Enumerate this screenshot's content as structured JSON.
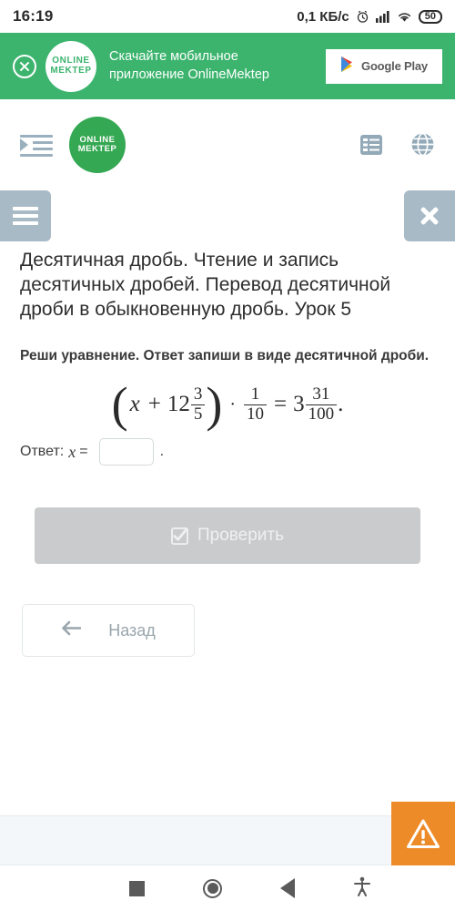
{
  "statusbar": {
    "time": "16:19",
    "network_speed": "0,1 КБ/с",
    "alarm_icon": "alarm-clock-icon",
    "signal_icon": "cellular-signal-icon",
    "wifi_icon": "wifi-icon",
    "battery_level": "50"
  },
  "promo_banner": {
    "close_icon": "close-circle-icon",
    "logo_line1": "ONLINE",
    "logo_line2": "MEKTEP",
    "text_line1": "Скачайте мобильное",
    "text_line2": "приложение OnlineMektep",
    "store_button_label": "Google Play",
    "bg_color": "#3cb46e"
  },
  "site_header": {
    "indent_icon": "indent-menu-icon",
    "logo_line1": "ONLINE",
    "logo_line2": "MEKTEP",
    "list_icon": "list-icon",
    "language_icon": "globe-icon",
    "logo_color": "#35a853"
  },
  "lesson": {
    "menu_icon": "hamburger-menu-icon",
    "close_icon": "close-x-icon",
    "control_color": "#a8bac6",
    "title": "Десятичная дробь. Чтение и запись десятичных дробей. Перевод десятичной дроби в обыкновенную дробь. Урок 5",
    "task": "Реши уравнение. Ответ запиши в виде десятичной дроби.",
    "equation": {
      "open_paren": "(",
      "variable": "x",
      "plus": "+",
      "whole1": "12",
      "frac1_num": "3",
      "frac1_den": "5",
      "close_paren": ")",
      "multiply": "·",
      "frac2_num": "1",
      "frac2_den": "10",
      "equals": "=",
      "whole2": "3",
      "frac3_num": "31",
      "frac3_den": "100",
      "period": "."
    },
    "answer": {
      "label": "Ответ:",
      "variable": "x",
      "equals": "=",
      "value": "",
      "placeholder": "",
      "period": "."
    },
    "check_button": {
      "label": "Проверить",
      "icon": "checkbox-checked-icon",
      "enabled": false,
      "bg_color": "#c9cbcd"
    },
    "back_button": {
      "label": "Назад",
      "icon": "arrow-left-icon"
    },
    "warning_fab": {
      "icon": "warning-triangle-icon",
      "bg_color": "#ee8b29"
    }
  },
  "navbar": {
    "recents_icon": "recents-square-icon",
    "home_icon": "home-circle-icon",
    "back_icon": "back-triangle-icon",
    "accessibility_icon": "accessibility-icon"
  }
}
